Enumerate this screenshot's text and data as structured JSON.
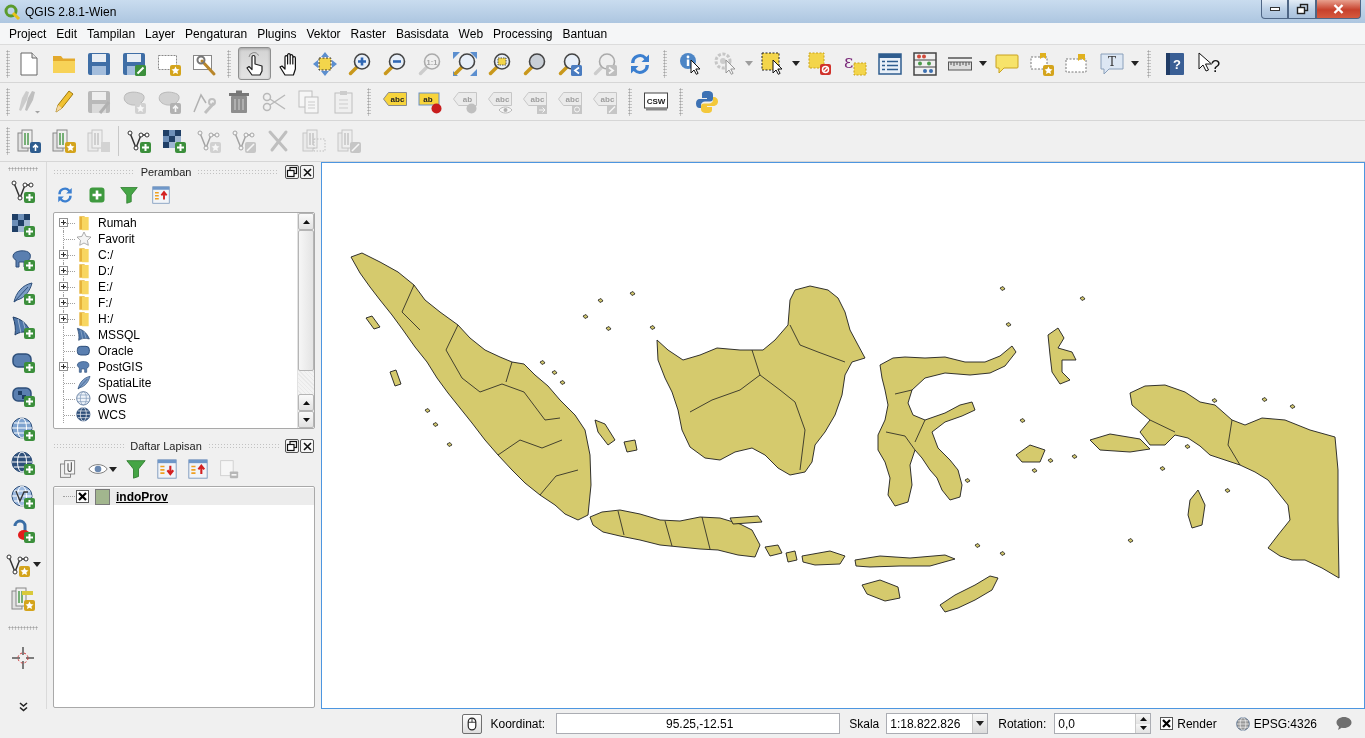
{
  "window": {
    "title": "QGIS 2.8.1-Wien"
  },
  "menu": [
    "Project",
    "Edit",
    "Tampilan",
    "Layer",
    "Pengaturan",
    "Plugins",
    "Vektor",
    "Raster",
    "Basisdata",
    "Web",
    "Processing",
    "Bantuan"
  ],
  "toolbars": [
    {
      "buttons": [
        {
          "disabled": false,
          "selected": false
        },
        {
          "disabled": false,
          "selected": false
        },
        {
          "disabled": false,
          "selected": false
        },
        {
          "disabled": false,
          "selected": false
        },
        {
          "disabled": false,
          "selected": false
        },
        {
          "disabled": false,
          "selected": false
        },
        {
          "disabled": false,
          "selected": true
        },
        {
          "disabled": false,
          "selected": false
        },
        {
          "disabled": false,
          "selected": false
        },
        {
          "disabled": false,
          "selected": false
        },
        {
          "disabled": false,
          "selected": false
        },
        {
          "disabled": true,
          "selected": false,
          "text": "1:1"
        },
        {
          "disabled": false,
          "selected": false
        },
        {
          "disabled": false,
          "selected": false
        },
        {
          "disabled": false,
          "selected": false
        },
        {
          "disabled": false,
          "selected": false
        },
        {
          "disabled": true,
          "selected": false
        },
        {
          "disabled": false,
          "selected": false
        },
        {
          "disabled": false,
          "selected": false
        },
        {
          "disabled": true,
          "selected": false
        },
        {
          "disabled": false,
          "selected": false
        },
        {
          "disabled": false,
          "selected": false
        },
        {
          "disabled": false,
          "selected": false,
          "text": "ε"
        },
        {
          "disabled": false,
          "selected": false
        },
        {
          "disabled": false,
          "selected": false
        },
        {
          "disabled": false,
          "selected": false
        },
        {
          "disabled": false,
          "selected": false
        },
        {
          "disabled": false,
          "selected": false
        },
        {
          "disabled": false,
          "selected": false
        },
        {
          "disabled": false,
          "selected": false,
          "text": "T"
        },
        {
          "disabled": false,
          "selected": false,
          "text": "?"
        },
        {
          "disabled": false,
          "selected": false,
          "text": "?"
        }
      ]
    },
    {
      "buttons": [
        {
          "disabled": true
        },
        {
          "disabled": false
        },
        {
          "disabled": true
        },
        {
          "disabled": true
        },
        {
          "disabled": true
        },
        {
          "disabled": true
        },
        {
          "disabled": false
        },
        {
          "disabled": true
        },
        {
          "disabled": true
        },
        {
          "disabled": true
        },
        {
          "disabled": false,
          "text": "abc"
        },
        {
          "disabled": false,
          "text": "ab"
        },
        {
          "disabled": true,
          "text": "ab"
        },
        {
          "disabled": true,
          "text": "abc"
        },
        {
          "disabled": true,
          "text": "abc"
        },
        {
          "disabled": true,
          "text": "abc"
        },
        {
          "disabled": true,
          "text": "abc"
        },
        {
          "disabled": false,
          "text": "CSW"
        },
        {
          "disabled": false
        }
      ]
    },
    {
      "buttons": [
        {
          "disabled": false
        },
        {
          "disabled": false
        },
        {
          "disabled": true
        },
        {
          "disabled": false
        },
        {
          "disabled": false
        },
        {
          "disabled": true
        },
        {
          "disabled": true
        },
        {
          "disabled": true
        },
        {
          "disabled": true
        },
        {
          "disabled": true
        }
      ]
    }
  ],
  "browser_panel": {
    "title": "Peramban",
    "items": [
      {
        "label": "Rumah",
        "kind": "folder",
        "expandable": true
      },
      {
        "label": "Favorit",
        "kind": "favorites",
        "expandable": false
      },
      {
        "label": "C:/",
        "kind": "folder",
        "expandable": true
      },
      {
        "label": "D:/",
        "kind": "folder",
        "expandable": true
      },
      {
        "label": "E:/",
        "kind": "folder",
        "expandable": true
      },
      {
        "label": "F:/",
        "kind": "folder",
        "expandable": true
      },
      {
        "label": "H:/",
        "kind": "folder",
        "expandable": true
      },
      {
        "label": "MSSQL",
        "kind": "mssql",
        "expandable": false
      },
      {
        "label": "Oracle",
        "kind": "oracle",
        "expandable": false
      },
      {
        "label": "PostGIS",
        "kind": "postgis",
        "expandable": true
      },
      {
        "label": "SpatiaLite",
        "kind": "spatialite",
        "expandable": false
      },
      {
        "label": "OWS",
        "kind": "ows",
        "expandable": false
      },
      {
        "label": "WCS",
        "kind": "wcs",
        "expandable": false
      }
    ]
  },
  "layers_panel": {
    "title": "Daftar Lapisan",
    "tools": [
      {
        "disabled": false
      },
      {
        "disabled": false
      },
      {
        "disabled": false
      },
      {
        "disabled": false
      },
      {
        "disabled": false
      },
      {
        "disabled": true
      }
    ],
    "layers": [
      {
        "name": "indoProv",
        "visible": true,
        "selected": true,
        "color": "#a2b68e"
      }
    ]
  },
  "status_bar": {
    "coordinate_label": "Koordinat:",
    "coordinate": "95.25,-12.51",
    "scale_label": "Skala",
    "scale": "1:18.822.826",
    "rotation_label": "Rotation:",
    "rotation": "0,0",
    "render": true,
    "render_label": "Render",
    "crs": "EPSG:4326"
  }
}
